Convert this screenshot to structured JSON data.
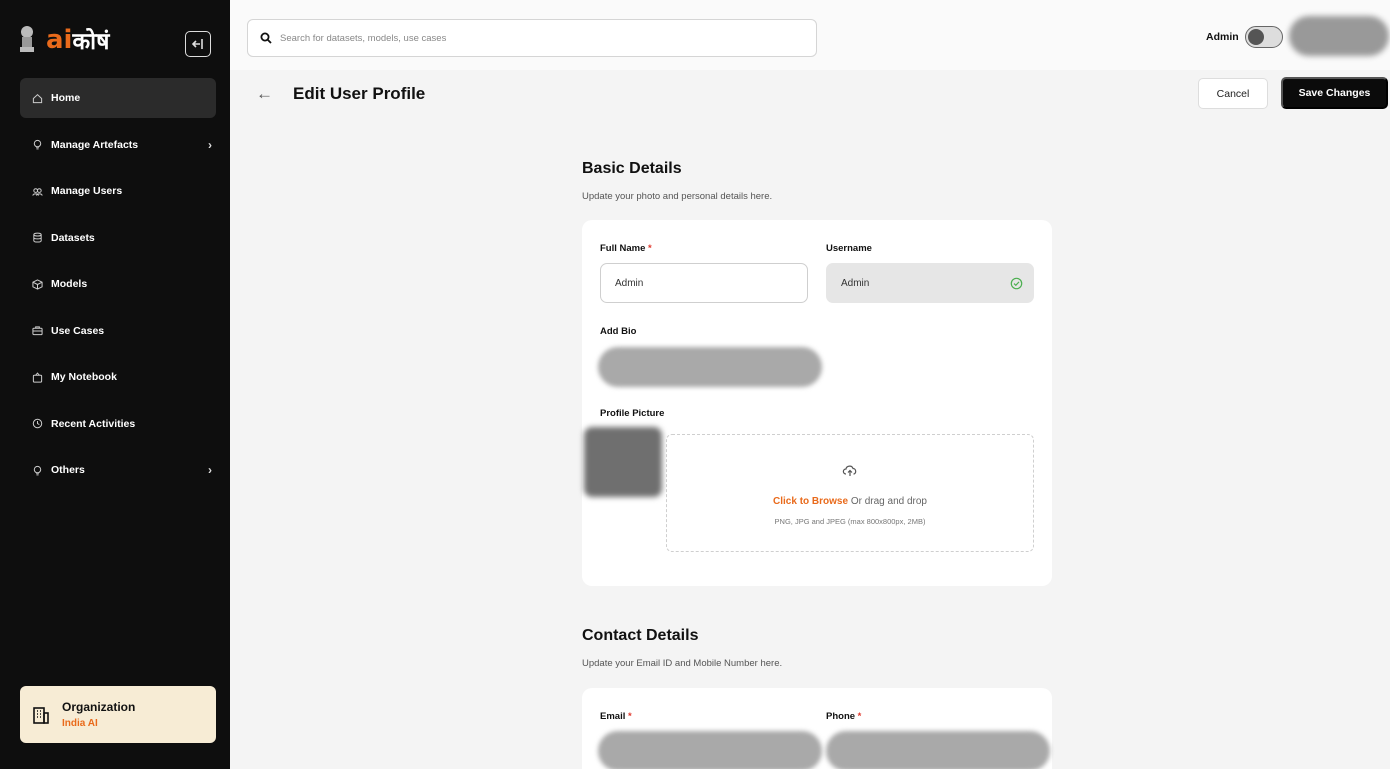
{
  "brand": {
    "ai": "ai",
    "kosh": "कोषं"
  },
  "sidebar": {
    "items": [
      {
        "label": "Home",
        "icon": "home-icon",
        "active": true
      },
      {
        "label": "Manage Artefacts",
        "icon": "bulb-icon",
        "has_children": true
      },
      {
        "label": "Manage Users",
        "icon": "users-icon"
      },
      {
        "label": "Datasets",
        "icon": "database-icon"
      },
      {
        "label": "Models",
        "icon": "cube-icon"
      },
      {
        "label": "Use Cases",
        "icon": "briefcase-icon"
      },
      {
        "label": "My Notebook",
        "icon": "notebook-icon"
      },
      {
        "label": "Recent Activities",
        "icon": "clock-icon"
      },
      {
        "label": "Others",
        "icon": "bulb-icon",
        "has_children": true
      }
    ],
    "org": {
      "title": "Organization",
      "name": "India AI",
      "icon": "building-icon"
    }
  },
  "topbar": {
    "search_placeholder": "Search for datasets, models, use cases",
    "admin_label": "Admin"
  },
  "header": {
    "title": "Edit User Profile",
    "cancel": "Cancel",
    "save": "Save Changes"
  },
  "basic": {
    "title": "Basic Details",
    "subtitle": "Update your photo and personal details here.",
    "full_name_label": "Full Name",
    "full_name_value": "Admin",
    "username_label": "Username",
    "username_value": "Admin",
    "bio_label": "Add Bio",
    "picture_label": "Profile Picture",
    "upload_link": "Click to Browse",
    "upload_rest": " Or drag and drop",
    "upload_hint": "PNG, JPG and JPEG (max 800x800px, 2MB)"
  },
  "contact": {
    "title": "Contact Details",
    "subtitle": "Update your Email ID and Mobile Number here.",
    "email_label": "Email",
    "phone_label": "Phone"
  },
  "required_marker": "*",
  "colors": {
    "accent": "#e96a1b",
    "sidebar_bg": "#0e0e0e",
    "required": "#e03a2f"
  }
}
